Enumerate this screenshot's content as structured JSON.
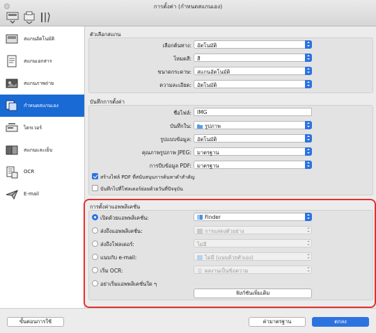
{
  "window": {
    "title": "การตั้งค่า (กำหนดสแกนเอง)"
  },
  "toolbar": {
    "icons": [
      "scan-settings-icon",
      "general-settings-icon",
      "tools-icon"
    ]
  },
  "sidebar": {
    "items": [
      {
        "label": "สแกนอัตโนมัติ",
        "icon": "auto-scan-icon",
        "selected": false
      },
      {
        "label": "สแกนเอกสาร",
        "icon": "document-scan-icon",
        "selected": false
      },
      {
        "label": "สแกนภาพถ่าย",
        "icon": "photo-scan-icon",
        "selected": false
      },
      {
        "label": "กำหนดสแกนเอง",
        "icon": "custom-scan-icon",
        "selected": true
      },
      {
        "label": "ไดรเวอร์",
        "icon": "driver-icon",
        "selected": false
      },
      {
        "label": "สแกนและเย็บ",
        "icon": "stitch-icon",
        "selected": false
      },
      {
        "label": "OCR",
        "icon": "ocr-icon",
        "selected": false
      },
      {
        "label": "E-mail",
        "icon": "email-icon",
        "selected": false
      }
    ]
  },
  "scan_options": {
    "title": "ตัวเลือกสแกน",
    "rows": [
      {
        "label": "เลือกต้นทาง:",
        "value": "อัตโนมัติ"
      },
      {
        "label": "โหมดสี:",
        "value": "สี"
      },
      {
        "label": "ขนาดกระดาษ:",
        "value": "สแกนอัตโนมัติ"
      },
      {
        "label": "ความละเอียด:",
        "value": "อัตโนมัติ"
      }
    ]
  },
  "save_settings": {
    "title": "บันทึกการตั้งค่า",
    "file_name_label": "ชื่อไฟล์:",
    "file_name_value": "IMG",
    "rows": [
      {
        "label": "บันทึกใน:",
        "value": "รูปภาพ",
        "icon": "folder-icon"
      },
      {
        "label": "รูปแบบข้อมูล:",
        "value": "อัตโนมัติ"
      },
      {
        "label": "คุณภาพรูปภาพ JPEG:",
        "value": "มาตรฐาน"
      },
      {
        "label": "การบีบข้อมูล PDF:",
        "value": "มาตรฐาน"
      }
    ],
    "checks": [
      {
        "label": "สร้างไฟล์ PDF ที่สนับสนุนการค้นหาคำสำคัญ",
        "checked": true
      },
      {
        "label": "บันทึกไปที่โฟลเดอร์ย่อยด้วยวันที่ปัจจุบัน",
        "checked": false
      }
    ]
  },
  "app_settings": {
    "title": "การตั้งค่าแอพพลิเคชั่น",
    "rows": [
      {
        "label": "เปิดด้วยแอพพลิเคชั่น:",
        "value": "Finder",
        "selected": true,
        "disabled": false,
        "icon": "finder-icon"
      },
      {
        "label": "ส่งถึงแอพพลิเคชั่น:",
        "value": "การแสดงตัวอย่าง",
        "selected": false,
        "disabled": true,
        "icon": "preview-icon"
      },
      {
        "label": "ส่งถึงโฟลเดอร์:",
        "value": "ไม่มี",
        "selected": false,
        "disabled": true
      },
      {
        "label": "แนบกับ e-mail:",
        "value": "ไม่มี (แนบด้วยตัวเอง)",
        "selected": false,
        "disabled": true,
        "icon": "mail-icon"
      },
      {
        "label": "เริ่ม OCR:",
        "value": "ผลงานเป็นข้อความ",
        "selected": false,
        "disabled": true,
        "icon": "text-doc-icon"
      },
      {
        "label": "อย่าเริ่มแอพพลิเคชั่นใด ๆ",
        "selected": false
      }
    ],
    "more_button": "ฟังก์ชันเพิ่มเติม"
  },
  "footer": {
    "guide_button": "ขั้นตอนการใช้",
    "defaults_button": "ค่ามาตรฐาน",
    "ok_button": "ตกลง"
  },
  "colors": {
    "accent": "#2d73e0",
    "selected_sidebar": "#1a6ad6",
    "highlight": "#e62d2d"
  }
}
